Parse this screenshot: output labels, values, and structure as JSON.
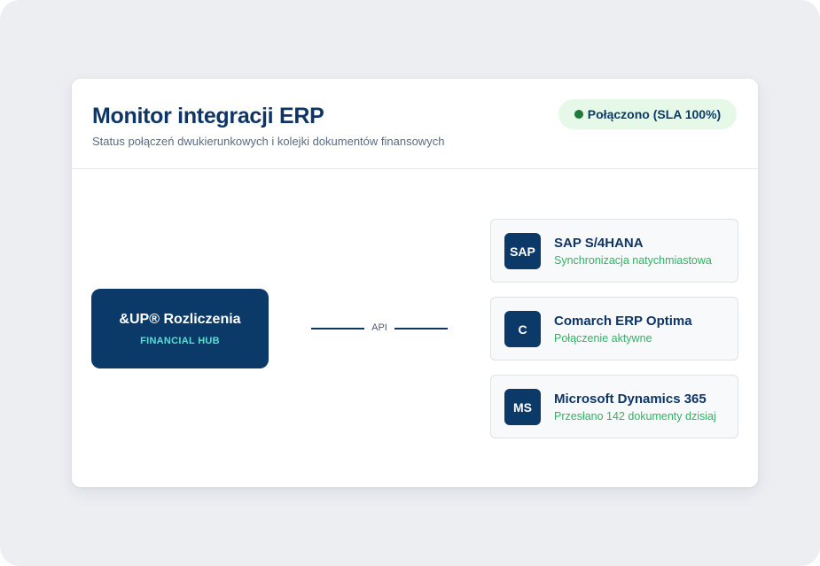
{
  "header": {
    "title": "Monitor integracji ERP",
    "subtitle": "Status połączeń dwukierunkowych i kolejki dokumentów finansowych",
    "status_label": "Połączono (SLA 100%)",
    "status_color": "#1f7a3a"
  },
  "hub": {
    "title": "&UP® Rozliczenia",
    "subtitle": "FINANCIAL HUB"
  },
  "connector": {
    "label": "API"
  },
  "erps": [
    {
      "logo": "SAP",
      "name": "SAP S/4HANA",
      "status": "Synchronizacja natychmiastowa"
    },
    {
      "logo": "C",
      "name": "Comarch ERP Optima",
      "status": "Połączenie aktywne"
    },
    {
      "logo": "MS",
      "name": "Microsoft Dynamics 365",
      "status": "Przesłano 142 dokumenty dzisiaj"
    }
  ],
  "colors": {
    "brand": "#0b3a68",
    "accent_teal": "#55e0d3",
    "success_text": "#2fb463",
    "pill_bg": "#e6f9e9"
  }
}
